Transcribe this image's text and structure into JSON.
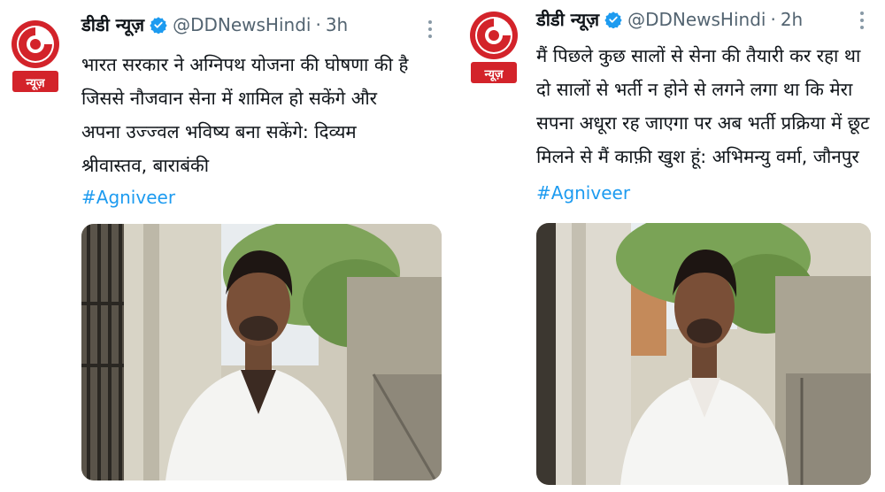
{
  "tweets": [
    {
      "author_name": "डीडी न्यूज़",
      "handle": "@DDNewsHindi",
      "separator": "·",
      "time": "3h",
      "logo_text": "न्यूज़",
      "lines": [
        "भारत सरकार ने अग्निपथ योजना की घोषणा की है",
        "जिससे नौजवान सेना में शामिल हो सकेंगे और",
        "अपना उज्ज्वल भविष्य बना सकेंगे: दिव्यम",
        "श्रीवास्तव, बाराबंकी"
      ],
      "hashtag": "#Agniveer"
    },
    {
      "author_name": "डीडी न्यूज़",
      "handle": "@DDNewsHindi",
      "separator": "·",
      "time": "2h",
      "logo_text": "न्यूज़",
      "lines": [
        "मैं पिछले कुछ सालों से सेना की तैयारी कर रहा था",
        "दो सालों से भर्ती न होने से  लगने लगा था कि मेरा",
        "सपना अधूरा रह जाएगा पर अब भर्ती प्रक्रिया में छूट",
        "मिलने से मैं काफ़ी खुश हूं: अभिमन्यु वर्मा, जौनपुर"
      ],
      "hashtag": "#Agniveer"
    }
  ],
  "colors": {
    "brand_red": "#d3232a",
    "verified_blue": "#1d9bf0",
    "hashtag_blue": "#1d9bf0",
    "muted_gray": "#536471"
  },
  "icons": {
    "verified": "verified-badge-icon",
    "more": "more-options-icon"
  }
}
